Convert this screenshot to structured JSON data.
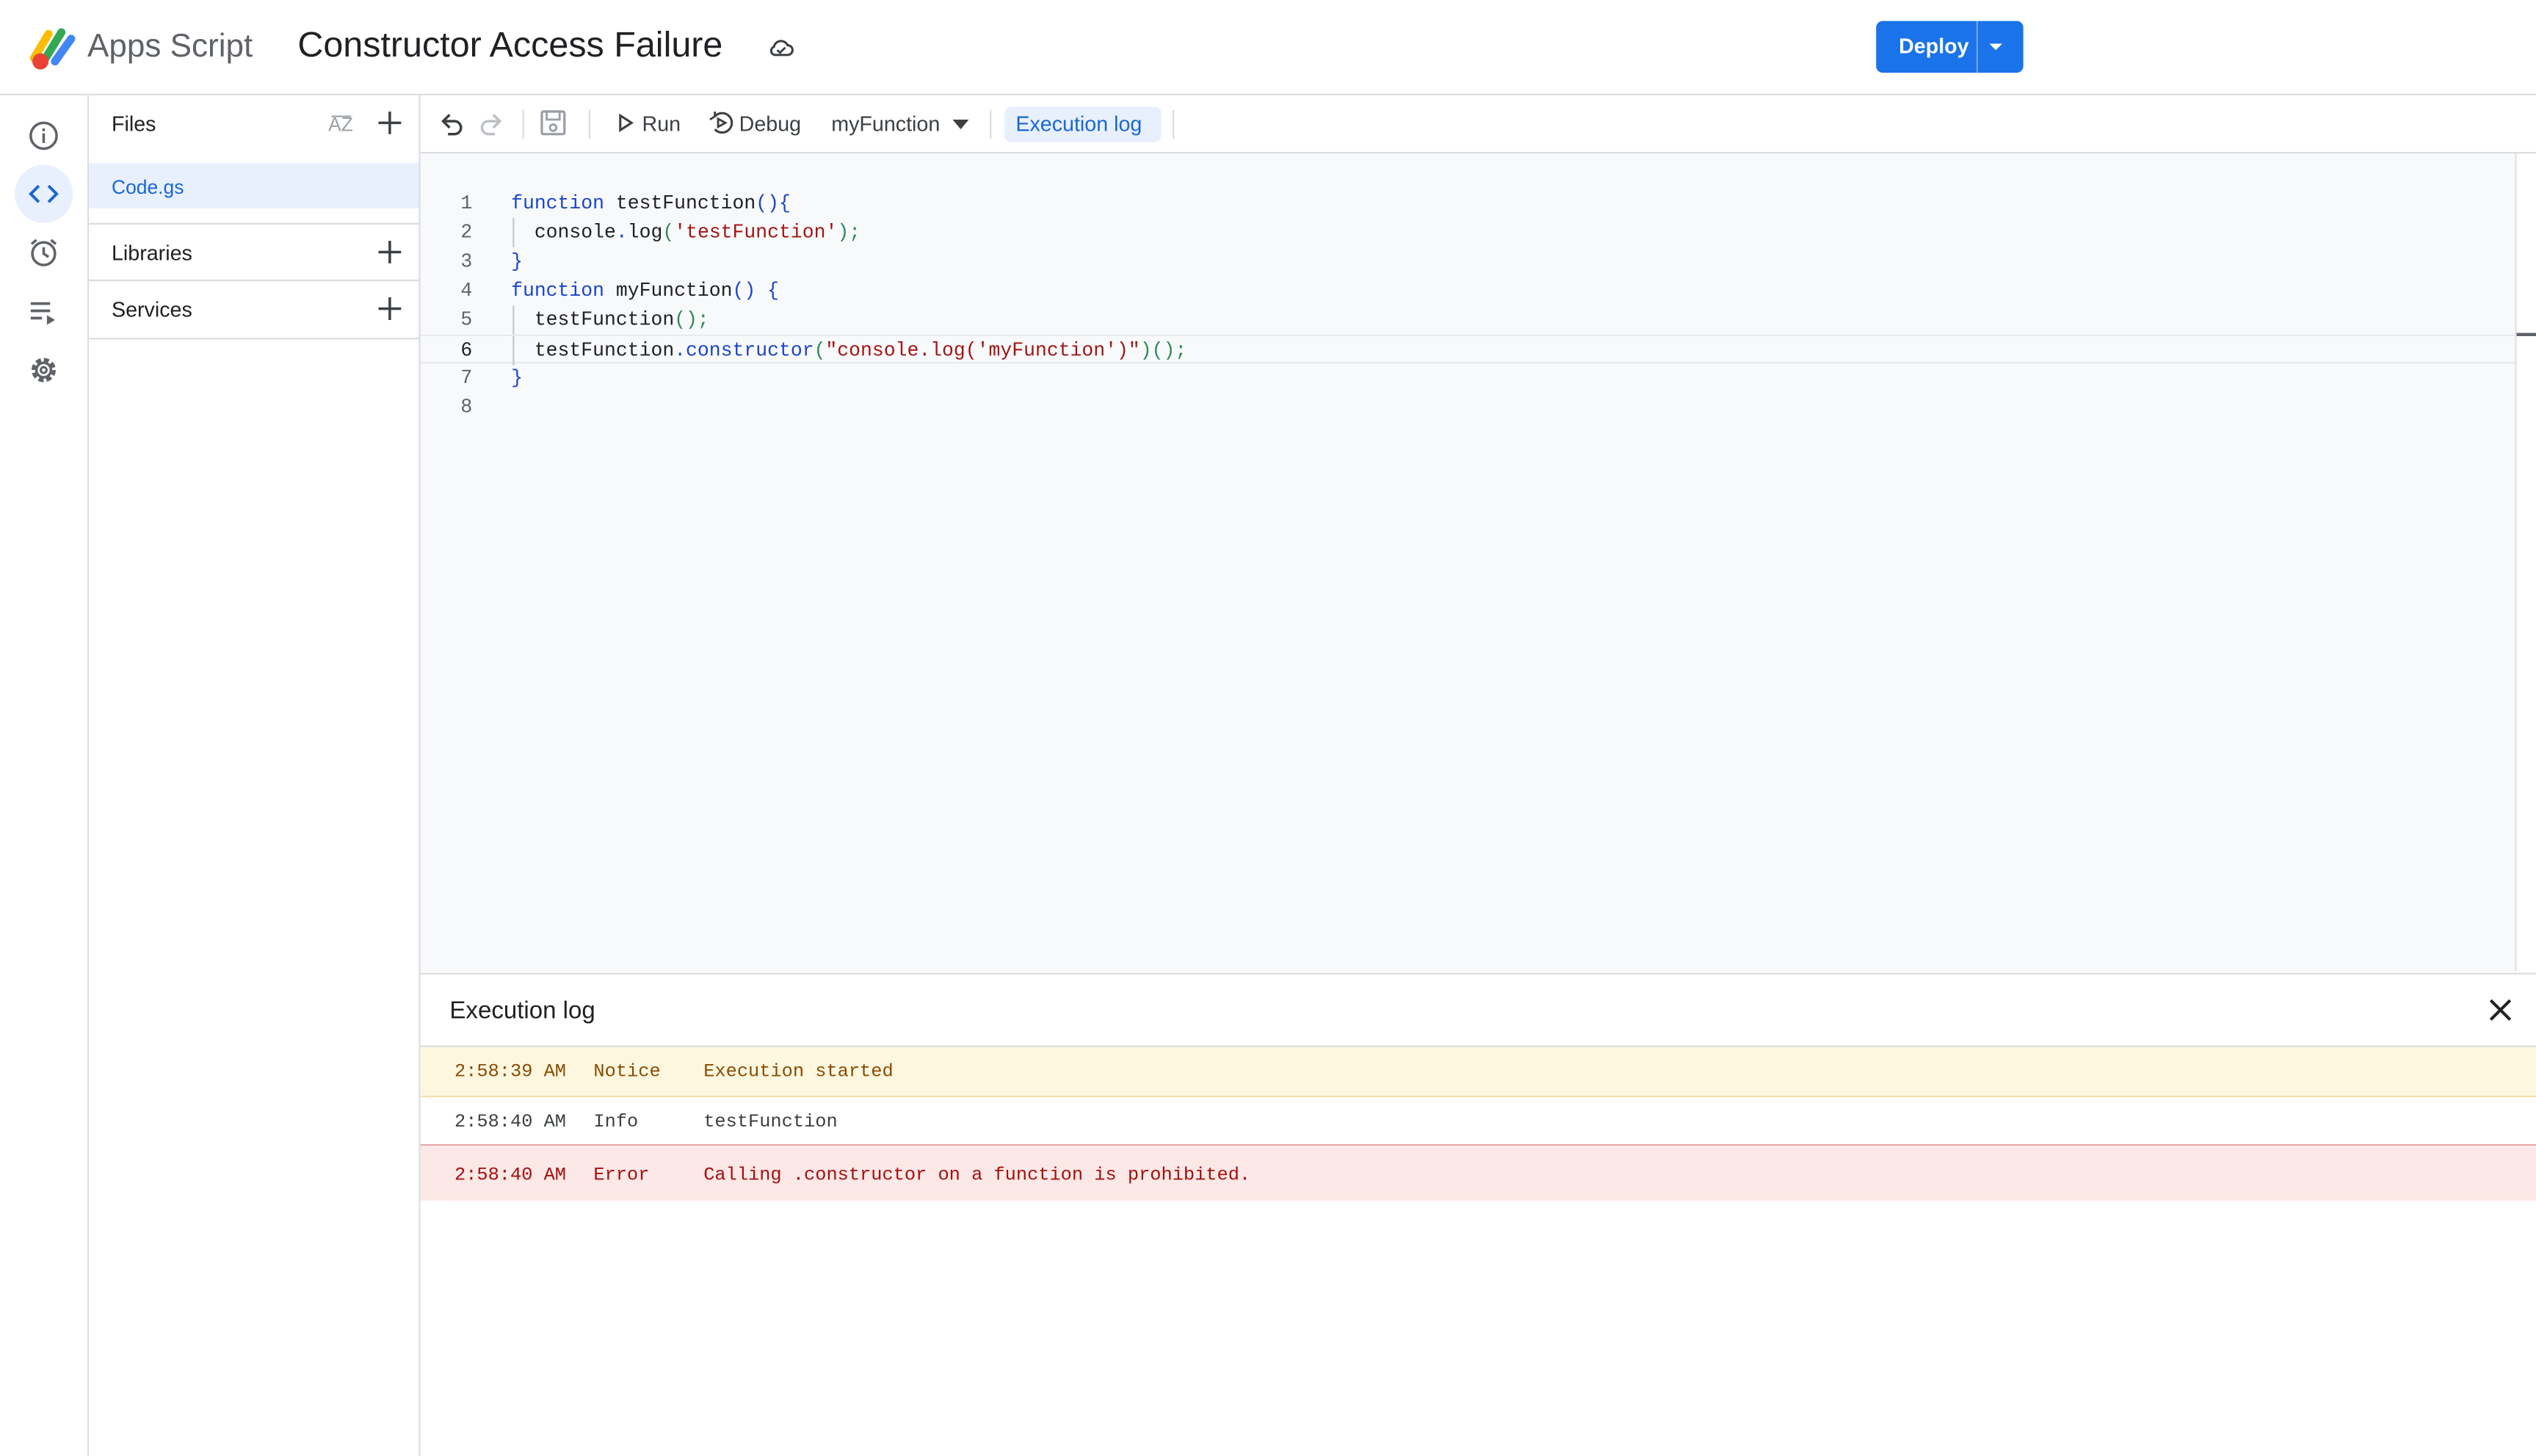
{
  "app": {
    "product_name": "Apps Script",
    "project_title": "Constructor Access Failure",
    "deploy_label": "Deploy"
  },
  "files_panel": {
    "title": "Files",
    "files": [
      {
        "name": "Code.gs"
      }
    ],
    "libraries_label": "Libraries",
    "services_label": "Services"
  },
  "toolbar": {
    "run_label": "Run",
    "debug_label": "Debug",
    "function_selected": "myFunction",
    "execution_log_label": "Execution log"
  },
  "editor": {
    "line_numbers": [
      "1",
      "2",
      "3",
      "4",
      "5",
      "6",
      "7",
      "8"
    ],
    "current_line": 6
  },
  "code_tokens": {
    "l1": [
      "function",
      "testFunction",
      "(){"
    ],
    "l2": [
      "console",
      ".",
      "log",
      "(",
      "'testFunction'",
      ");"
    ],
    "l3": [
      "}"
    ],
    "l4": [
      "function",
      "myFunction",
      "()",
      "{"
    ],
    "l5": [
      "testFunction",
      "();"
    ],
    "l6": [
      "testFunction",
      ".",
      "constructor",
      "(",
      "\"console.log('myFunction')\"",
      ")",
      "();"
    ],
    "l7": [
      "}"
    ]
  },
  "execution_log": {
    "title": "Execution log",
    "entries": [
      {
        "time": "2:58:39 AM",
        "level": "Notice",
        "message": "Execution started"
      },
      {
        "time": "2:58:40 AM",
        "level": "Info",
        "message": "testFunction"
      },
      {
        "time": "2:58:40 AM",
        "level": "Error",
        "message": "Calling .constructor on a function is prohibited."
      }
    ]
  },
  "colors": {
    "accent": "#1a73e8",
    "selected_bg": "#e8f0fe",
    "notice_bg": "#fef7e0",
    "error_bg": "#fce8e6",
    "keyword": "#1a46c8",
    "string": "#a31515"
  },
  "icons": {
    "logo": "apps-script-logo",
    "cloud": "cloud-icon",
    "rail": [
      "info-icon",
      "code-icon",
      "clock-icon",
      "executions-icon",
      "gear-icon"
    ],
    "toolbar": [
      "undo-icon",
      "redo-icon",
      "save-icon",
      "play-icon",
      "debug-icon",
      "chevron-down-icon"
    ]
  }
}
